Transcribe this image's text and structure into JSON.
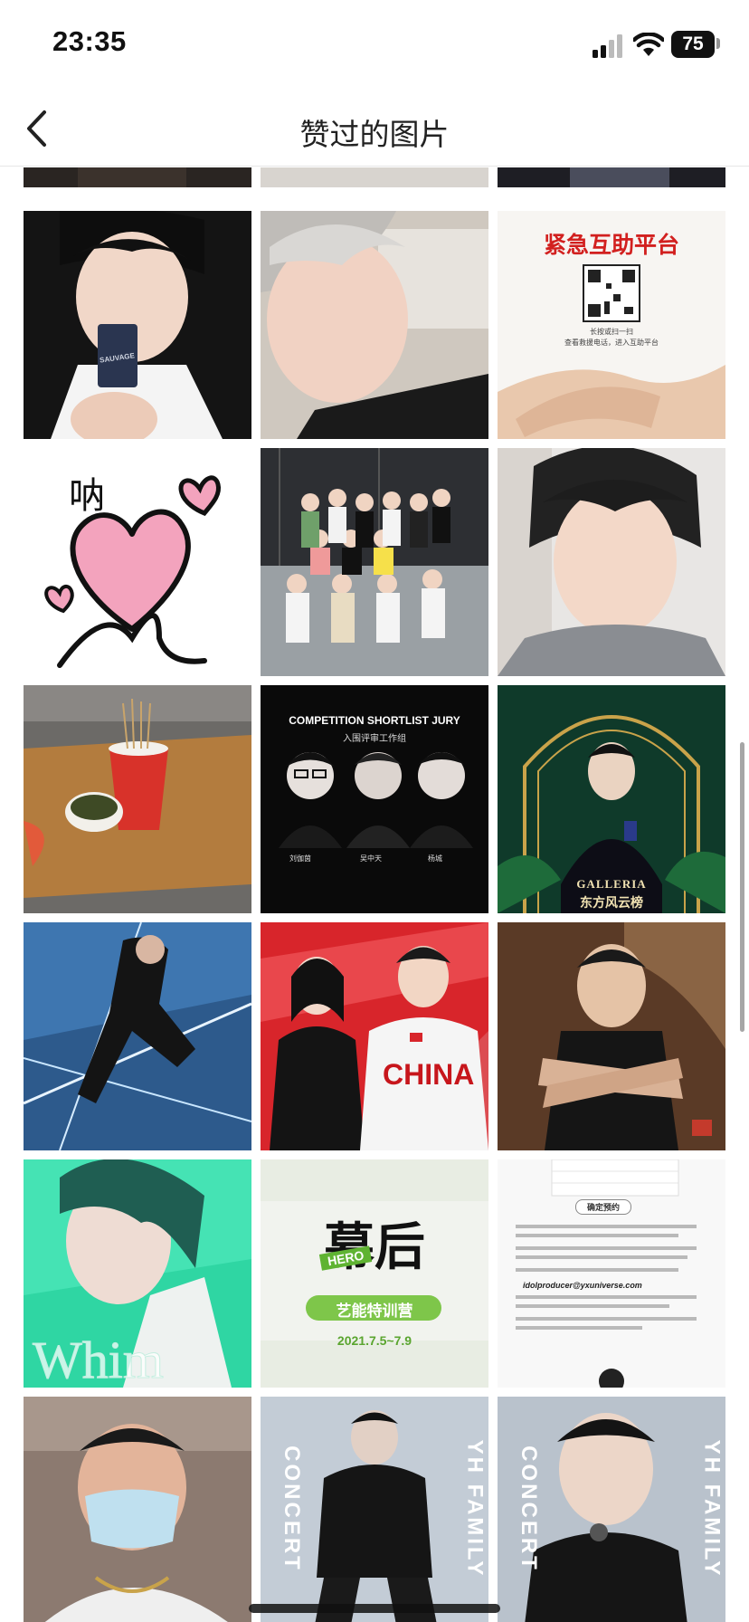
{
  "status_bar": {
    "time": "23:35",
    "battery": "75",
    "icons": [
      "signal-icon",
      "wifi-icon",
      "battery-icon"
    ]
  },
  "nav": {
    "title": "赞过的图片",
    "back_icon": "chevron-left-icon"
  },
  "grid": {
    "rows": [
      {
        "tiles": [
          {
            "label": "partial-photo-dark",
            "captions": []
          },
          {
            "label": "partial-photo-light",
            "captions": []
          },
          {
            "label": "partial-photo-dark-2",
            "captions": []
          }
        ]
      },
      {
        "tiles": [
          {
            "label": "portrait-with-perfume",
            "captions": [
              "SAUVAGE"
            ]
          },
          {
            "label": "selfie-silver-hair",
            "captions": []
          },
          {
            "label": "poster-mutual-aid-platform",
            "captions": [
              "紧急互助平台",
              "长按或扫一扫",
              "查看救援电话，进入互助平台"
            ]
          }
        ]
      },
      {
        "tiles": [
          {
            "label": "heart-doodle",
            "captions": [
              "呐"
            ]
          },
          {
            "label": "group-photo-studio",
            "captions": []
          },
          {
            "label": "selfie-grey-tee",
            "captions": []
          }
        ]
      },
      {
        "tiles": [
          {
            "label": "food-on-table",
            "captions": []
          },
          {
            "label": "competition-jury-poster",
            "captions": [
              "COMPETITION SHORTLIST JURY",
              "入围评审工作组",
              "刘伽茵",
              "吴中天",
              "杨城"
            ]
          },
          {
            "label": "galleria-portrait",
            "captions": [
              "GALLERIA",
              "东方风云榜"
            ]
          }
        ]
      },
      {
        "tiles": [
          {
            "label": "dance-pose-laser",
            "captions": []
          },
          {
            "label": "china-duo-poster",
            "captions": [
              "CHINA"
            ]
          },
          {
            "label": "arms-crossed-portrait",
            "captions": []
          }
        ]
      },
      {
        "tiles": [
          {
            "label": "whim-portrait",
            "captions": [
              "Whim"
            ]
          },
          {
            "label": "hero-training-camp",
            "captions": [
              "幕后",
              "HERO",
              "艺能特训营",
              "2021.7.5~7.9"
            ]
          },
          {
            "label": "registration-notice",
            "captions": [
              "确定预约",
              "idolproducer@yxuniverse.com"
            ]
          }
        ]
      },
      {
        "tiles": [
          {
            "label": "masked-selfie",
            "captions": []
          },
          {
            "label": "concert-poster-1",
            "captions": [
              "CONCERT",
              "YH FAMILY"
            ]
          },
          {
            "label": "concert-poster-2",
            "captions": [
              "CONCERT",
              "YH FAMILY"
            ]
          }
        ]
      }
    ]
  },
  "colors": {
    "background": "#ffffff",
    "title": "#222222",
    "divider": "#e6e6e6"
  }
}
